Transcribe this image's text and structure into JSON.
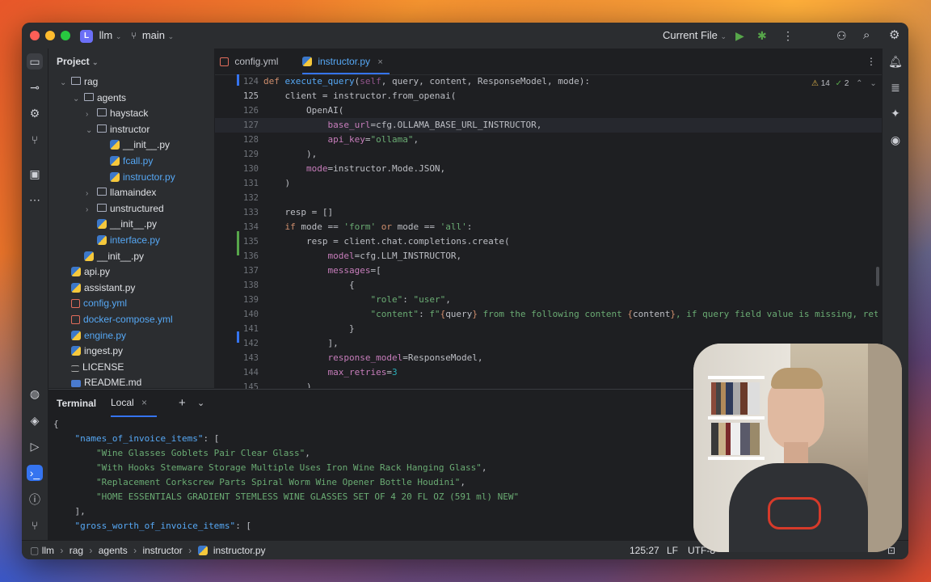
{
  "titlebar": {
    "project_badge": "L",
    "project_name": "llm",
    "branch": "main",
    "run_config": "Current File"
  },
  "project_panel": {
    "title": "Project",
    "items": [
      {
        "label": "rag",
        "type": "folder",
        "depth": 1,
        "expanded": true
      },
      {
        "label": "agents",
        "type": "folder",
        "depth": 2,
        "expanded": true
      },
      {
        "label": "haystack",
        "type": "folder",
        "depth": 3,
        "expanded": false
      },
      {
        "label": "instructor",
        "type": "folder",
        "depth": 3,
        "expanded": true
      },
      {
        "label": "__init__.py",
        "type": "py",
        "depth": 4
      },
      {
        "label": "fcall.py",
        "type": "py",
        "depth": 4,
        "color": "#56a8f5"
      },
      {
        "label": "instructor.py",
        "type": "py",
        "depth": 4,
        "color": "#56a8f5"
      },
      {
        "label": "llamaindex",
        "type": "folder",
        "depth": 3,
        "expanded": false
      },
      {
        "label": "unstructured",
        "type": "folder",
        "depth": 3,
        "expanded": false
      },
      {
        "label": "__init__.py",
        "type": "py",
        "depth": 3
      },
      {
        "label": "interface.py",
        "type": "py",
        "depth": 3,
        "color": "#56a8f5"
      },
      {
        "label": "__init__.py",
        "type": "py",
        "depth": 2
      },
      {
        "label": "api.py",
        "type": "py",
        "depth": 1
      },
      {
        "label": "assistant.py",
        "type": "py",
        "depth": 1
      },
      {
        "label": "config.yml",
        "type": "yml",
        "depth": 1,
        "color": "#56a8f5"
      },
      {
        "label": "docker-compose.yml",
        "type": "yml",
        "depth": 1,
        "color": "#56a8f5"
      },
      {
        "label": "engine.py",
        "type": "py",
        "depth": 1,
        "color": "#56a8f5"
      },
      {
        "label": "ingest.py",
        "type": "py",
        "depth": 1
      },
      {
        "label": "LICENSE",
        "type": "lic",
        "depth": 1
      },
      {
        "label": "README.md",
        "type": "md",
        "depth": 1
      }
    ]
  },
  "editor": {
    "tabs": [
      {
        "label": "config.yml",
        "active": false
      },
      {
        "label": "instructor.py",
        "active": true
      }
    ],
    "inspections": {
      "warnings": "14",
      "ok": "2"
    },
    "line_numbers": [
      "124",
      "125",
      "126",
      "127",
      "128",
      "129",
      "130",
      "131",
      "132",
      "133",
      "134",
      "135",
      "136",
      "137",
      "138",
      "139",
      "140",
      "141",
      "142",
      "143",
      "144",
      "145"
    ],
    "lines": [
      "<span class='kw'>def</span> <span class='fn'>execute_query</span>(<span class='slf'>self</span>, query, content, ResponseModel, mode):",
      "    client = instructor.from_openai(",
      "        OpenAI(",
      "            <span class='prm'>base_url</span>=cfg.OLLAMA_BASE_URL_INSTRUCTOR,",
      "            <span class='prm'>api_key</span>=<span class='str'>\"ollama\"</span>,",
      "        ),",
      "        <span class='prm'>mode</span>=instructor.Mode.JSON,",
      "    )",
      "",
      "    resp = []",
      "    <span class='kw'>if</span> mode == <span class='str'>'form'</span> <span class='kw'>or</span> mode == <span class='str'>'all'</span>:",
      "        resp = client.chat.completions.create(",
      "            <span class='prm'>model</span>=cfg.LLM_INSTRUCTOR,",
      "            <span class='prm'>messages</span>=[",
      "                {",
      "                    <span class='str'>\"role\"</span>: <span class='str'>\"user\"</span>,",
      "                    <span class='str'>\"content\"</span>: <span class='str'>f\"</span><span class='kw'>{</span>query<span class='kw'>}</span><span class='str'> from the following content </span><span class='kw'>{</span>content<span class='kw'>}</span><span class='str'>, if query field value is missing, return</span>",
      "                }",
      "            ],",
      "            <span class='prm'>response_model</span>=ResponseModel,",
      "            <span class='prm'>max_retries</span>=<span class='num'>3</span>",
      "        )"
    ]
  },
  "terminal": {
    "title": "Terminal",
    "tab": "Local",
    "lines": [
      "{",
      "    <span class='fn'>\"names_of_invoice_items\"</span>: [",
      "        <span class='str'>\"Wine Glasses Goblets Pair Clear Glass\"</span>,",
      "        <span class='str'>\"With Hooks Stemware Storage Multiple Uses Iron Wine Rack Hanging Glass\"</span>,",
      "        <span class='str'>\"Replacement Corkscrew Parts Spiral Worm Wine Opener Bottle Houdini\"</span>,",
      "        <span class='str'>\"HOME ESSENTIALS GRADIENT STEMLESS WINE GLASSES SET OF 4 20 FL OZ (591 ml) NEW\"</span>",
      "    ],",
      "    <span class='fn'>\"gross_worth_of_invoice_items\"</span>: ["
    ]
  },
  "statusbar": {
    "breadcrumb": [
      "llm",
      "rag",
      "agents",
      "instructor",
      "instructor.py"
    ],
    "position": "125:27",
    "line_ending": "LF",
    "encoding": "UTF-8"
  },
  "colors": {
    "accent": "#3574f0",
    "window_bg": "#1e1f22",
    "panel_bg": "#2b2d30"
  }
}
